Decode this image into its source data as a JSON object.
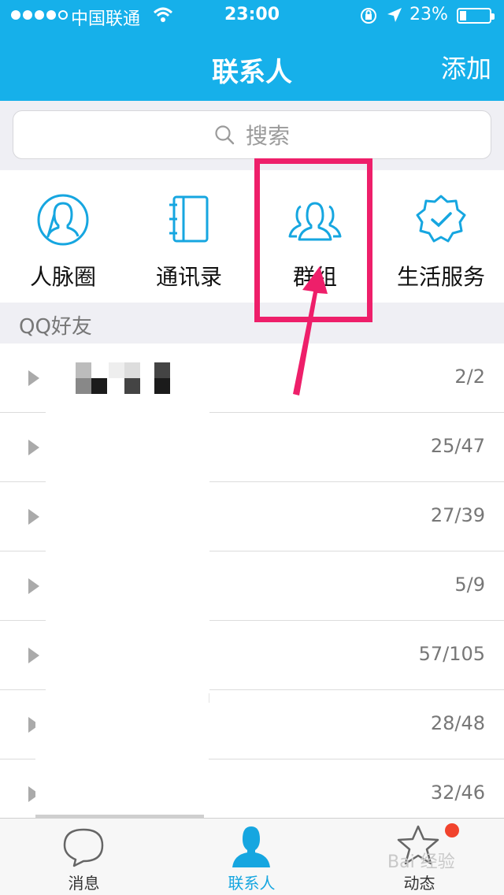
{
  "status_bar": {
    "carrier": "中国联通",
    "time": "23:00",
    "battery": "23%",
    "battery_level": 0.23
  },
  "nav": {
    "title": "联系人",
    "add_label": "添加"
  },
  "search": {
    "placeholder": "搜索"
  },
  "quick_entries": [
    {
      "label": "人脉圈",
      "icon": "person-circle-icon"
    },
    {
      "label": "通讯录",
      "icon": "address-book-icon"
    },
    {
      "label": "群组",
      "icon": "group-icon"
    },
    {
      "label": "生活服务",
      "icon": "verified-badge-icon"
    }
  ],
  "section_header": "QQ好友",
  "friend_groups": [
    {
      "count": "2/2"
    },
    {
      "count": "25/47"
    },
    {
      "count": "27/39"
    },
    {
      "count": "5/9"
    },
    {
      "count": "57/105"
    },
    {
      "count": "28/48"
    },
    {
      "count": "32/46"
    }
  ],
  "tabs": [
    {
      "label": "消息",
      "icon": "chat-bubble-icon",
      "active": false
    },
    {
      "label": "联系人",
      "icon": "contact-person-icon",
      "active": true
    },
    {
      "label": "动态",
      "icon": "star-icon",
      "active": false
    }
  ],
  "watermark": "Bai 经验",
  "colors": {
    "primary": "#16b0ea",
    "highlight": "#ee1f6a",
    "badge": "#f1432d"
  }
}
